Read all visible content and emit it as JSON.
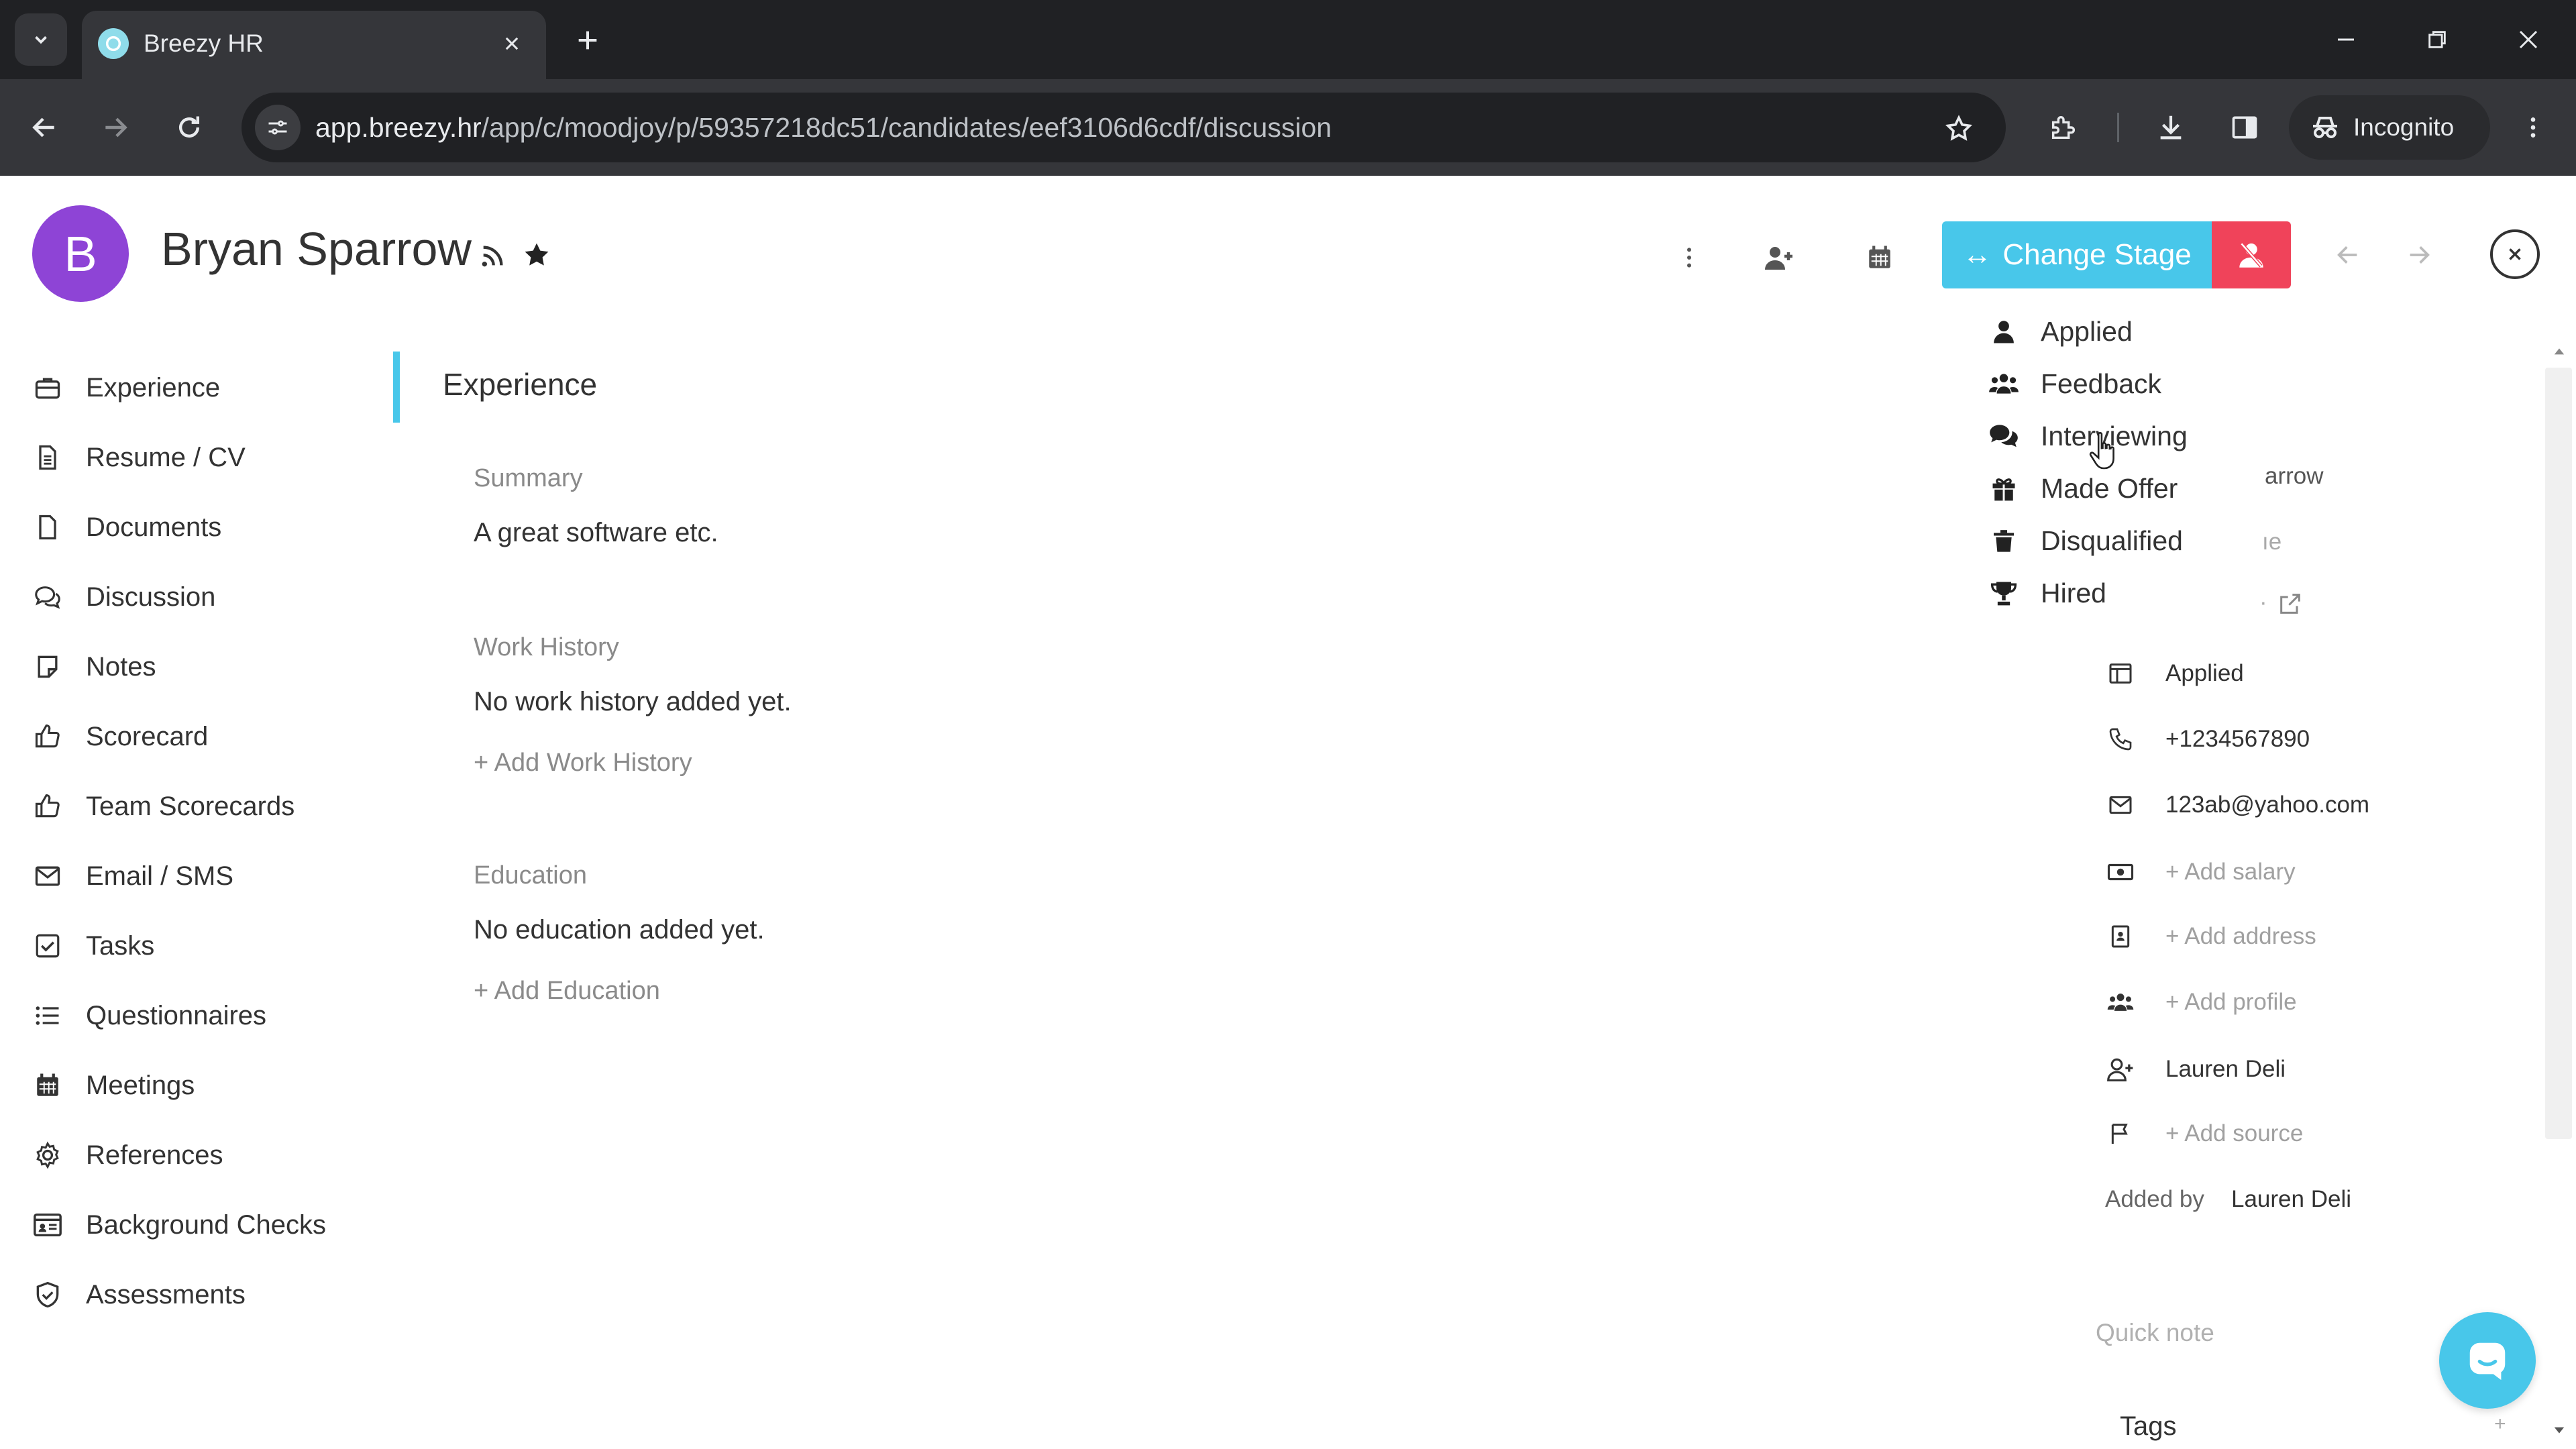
{
  "browser": {
    "tab_title": "Breezy HR",
    "url_host": "app.breezy.hr",
    "url_path": "/app/c/moodjoy/p/59357218dc51/candidates/eef3106d6cdf/discussion",
    "incognito_label": "Incognito"
  },
  "candidate": {
    "initial": "B",
    "name": "Bryan Sparrow",
    "change_stage_label": "Change Stage"
  },
  "sidebar": {
    "items": [
      {
        "label": "Experience",
        "icon": "briefcase-icon"
      },
      {
        "label": "Resume / CV",
        "icon": "file-text-icon"
      },
      {
        "label": "Documents",
        "icon": "file-icon"
      },
      {
        "label": "Discussion",
        "icon": "comments-icon"
      },
      {
        "label": "Notes",
        "icon": "sticky-note-icon"
      },
      {
        "label": "Scorecard",
        "icon": "thumbs-up-icon"
      },
      {
        "label": "Team Scorecards",
        "icon": "thumbs-up-icon"
      },
      {
        "label": "Email / SMS",
        "icon": "envelope-icon"
      },
      {
        "label": "Tasks",
        "icon": "checkbox-icon"
      },
      {
        "label": "Questionnaires",
        "icon": "list-icon"
      },
      {
        "label": "Meetings",
        "icon": "calendar-icon"
      },
      {
        "label": "References",
        "icon": "gear-icon"
      },
      {
        "label": "Background Checks",
        "icon": "id-card-icon"
      },
      {
        "label": "Assessments",
        "icon": "shield-check-icon"
      }
    ]
  },
  "main": {
    "section_title": "Experience",
    "summary_label": "Summary",
    "summary_text": "A great software etc.",
    "work_history_label": "Work History",
    "work_history_empty": "No work history added yet.",
    "add_work_history": "+ Add Work History",
    "education_label": "Education",
    "education_empty": "No education added yet.",
    "add_education": "+ Add Education"
  },
  "stage_menu": {
    "items": [
      {
        "label": "Applied",
        "icon": "user-icon"
      },
      {
        "label": "Feedback",
        "icon": "users-icon"
      },
      {
        "label": "Interviewing",
        "icon": "chat-icon"
      },
      {
        "label": "Made Offer",
        "icon": "gift-icon"
      },
      {
        "label": "Disqualified",
        "icon": "trash-icon"
      },
      {
        "label": "Hired",
        "icon": "trophy-icon"
      }
    ]
  },
  "info_panel": {
    "peek_1": "arrow",
    "peek_2": "ıe",
    "peek_3": "·",
    "stage": "Applied",
    "phone": "+1234567890",
    "email": "123ab@yahoo.com",
    "add_salary": "+ Add salary",
    "add_address": "+ Add address",
    "add_profile": "+ Add profile",
    "owner": "Lauren Deli",
    "add_source": "+ Add source",
    "added_by_label": "Added by",
    "added_by": "Lauren Deli",
    "quick_note_placeholder": "Quick note",
    "tags_label": "Tags",
    "tags_add": "+"
  },
  "colors": {
    "accent": "#48c7ea",
    "danger": "#f0435a",
    "avatar": "#8e44d6"
  }
}
